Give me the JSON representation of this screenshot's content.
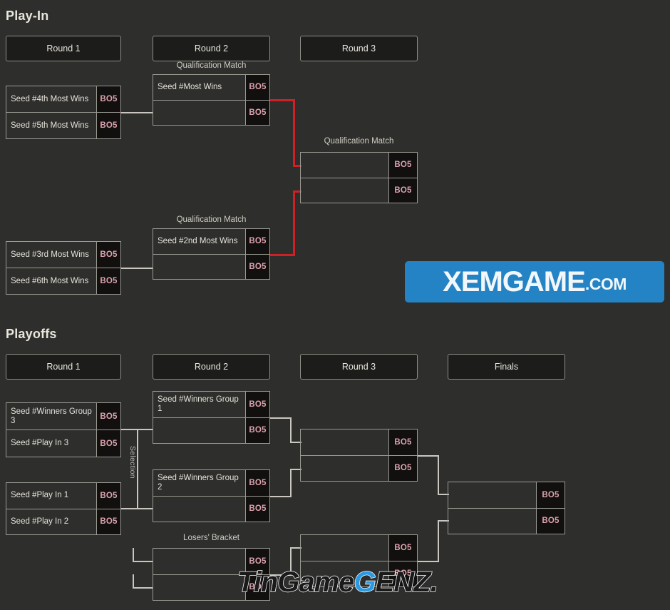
{
  "page": {
    "background_color": "#2e2e2c",
    "line_color": "#c9c7bf",
    "red_line_color": "#cf2026",
    "format_text_color": "#dba3ad"
  },
  "sections": [
    {
      "id": "play-in",
      "title": "Play-In",
      "round_headers": [
        {
          "label": "Round 1"
        },
        {
          "label": "Round 2"
        },
        {
          "label": "Round 3"
        }
      ],
      "captions": [
        {
          "label": "Qualification Match"
        },
        {
          "label": "Qualification Match"
        },
        {
          "label": "Qualification Match"
        }
      ],
      "matches": [
        {
          "id": "pi-r1-m1",
          "slots": [
            {
              "team": "Seed #4th Most Wins",
              "format": "BO5"
            },
            {
              "team": "Seed #5th Most Wins",
              "format": "BO5"
            }
          ]
        },
        {
          "id": "pi-r1-m2",
          "slots": [
            {
              "team": "Seed #3rd Most Wins",
              "format": "BO5"
            },
            {
              "team": "Seed #6th Most Wins",
              "format": "BO5"
            }
          ]
        },
        {
          "id": "pi-r2-m1",
          "slots": [
            {
              "team": "Seed #Most Wins",
              "format": "BO5"
            },
            {
              "team": "",
              "format": "BO5"
            }
          ]
        },
        {
          "id": "pi-r2-m2",
          "slots": [
            {
              "team": "Seed #2nd Most Wins",
              "format": "BO5"
            },
            {
              "team": "",
              "format": "BO5"
            }
          ]
        },
        {
          "id": "pi-r3-m1",
          "slots": [
            {
              "team": "",
              "format": "BO5"
            },
            {
              "team": "",
              "format": "BO5"
            }
          ]
        }
      ]
    },
    {
      "id": "playoffs",
      "title": "Playoffs",
      "round_headers": [
        {
          "label": "Round 1"
        },
        {
          "label": "Round 2"
        },
        {
          "label": "Round 3"
        },
        {
          "label": "Finals"
        }
      ],
      "captions": [
        {
          "label": "Losers' Bracket"
        }
      ],
      "selection_label": "Selection",
      "matches": [
        {
          "id": "po-r1-m1",
          "slots": [
            {
              "team": "Seed #Winners Group 3",
              "format": "BO5"
            },
            {
              "team": "Seed #Play In 3",
              "format": "BO5"
            }
          ]
        },
        {
          "id": "po-r1-m2",
          "slots": [
            {
              "team": "Seed #Play In 1",
              "format": "BO5"
            },
            {
              "team": "Seed #Play In 2",
              "format": "BO5"
            }
          ]
        },
        {
          "id": "po-r2-m1",
          "slots": [
            {
              "team": "Seed #Winners Group 1",
              "format": "BO5"
            },
            {
              "team": "",
              "format": "BO5"
            }
          ]
        },
        {
          "id": "po-r2-m2",
          "slots": [
            {
              "team": "Seed #Winners Group 2",
              "format": "BO5"
            },
            {
              "team": "",
              "format": "BO5"
            }
          ]
        },
        {
          "id": "po-r2-m3",
          "slots": [
            {
              "team": "",
              "format": "BO5"
            },
            {
              "team": "",
              "format": "BO5"
            }
          ]
        },
        {
          "id": "po-r3-m1",
          "slots": [
            {
              "team": "",
              "format": "BO5"
            },
            {
              "team": "",
              "format": "BO5"
            }
          ]
        },
        {
          "id": "po-r3-m2",
          "slots": [
            {
              "team": "",
              "format": "BO5"
            },
            {
              "team": "",
              "format": "BO5"
            }
          ]
        },
        {
          "id": "po-finals-m1",
          "slots": [
            {
              "team": "",
              "format": "BO5"
            },
            {
              "team": "",
              "format": "BO5"
            }
          ]
        }
      ]
    }
  ],
  "watermarks": {
    "xemgame": {
      "main": "XEMGAME",
      "suffix": ".COM",
      "color": "#2383c4"
    },
    "tingamegenz": {
      "prefix": "TinGame",
      "accent": "G",
      "suffix": "ENZ.",
      "accent_color": "#2b9ae0"
    }
  }
}
